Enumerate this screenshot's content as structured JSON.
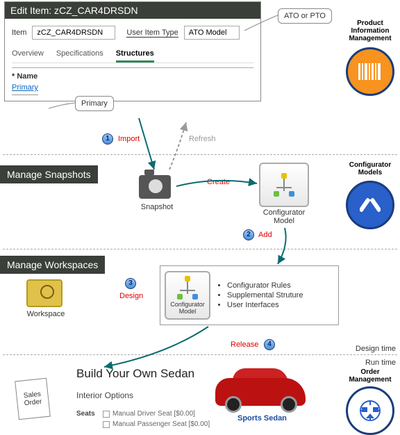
{
  "edit_item": {
    "title": "Edit Item: zCZ_CAR4DRSDN",
    "item_label": "Item",
    "item_value": "zCZ_CAR4DRSDN",
    "user_item_type_label": "User Item Type",
    "user_item_type_value": "ATO Model",
    "tabs": {
      "overview": "Overview",
      "specifications": "Specifications",
      "structures": "Structures"
    },
    "name_label": "* Name",
    "primary": "Primary"
  },
  "callouts": {
    "ato_pto": "ATO or PTO",
    "primary": "Primary"
  },
  "steps": {
    "s1": "1",
    "s2": "2",
    "s3": "3",
    "s4": "4"
  },
  "arrows": {
    "import": "Import",
    "refresh": "Refresh",
    "create": "Create",
    "add": "Add",
    "design": "Design",
    "release": "Release"
  },
  "sections": {
    "manage_snapshots": "Manage Snapshots",
    "manage_workspaces": "Manage Workspaces"
  },
  "icons": {
    "snapshot": "Snapshot",
    "configurator_model": "Configurator Model",
    "workspace": "Workspace"
  },
  "workspace_detail": {
    "bullets": [
      "Configurator Rules",
      "Supplemental Struture",
      "User Interfaces"
    ]
  },
  "phase": {
    "design_time": "Design time",
    "run_time": "Run time"
  },
  "runtime": {
    "build_title": "Build Your Own Sedan",
    "interior": "Interior Options",
    "seats_label": "Seats",
    "seat1": "Manual Driver Seat [$0.00]",
    "seat2": "Manual Passenger Seat [$0.00]",
    "car_label": "Sports Sedan",
    "sales_order": "Sales Order"
  },
  "badges": {
    "pim": "Product Information Management",
    "cm": "Configurator Models",
    "om": "Order Management"
  }
}
